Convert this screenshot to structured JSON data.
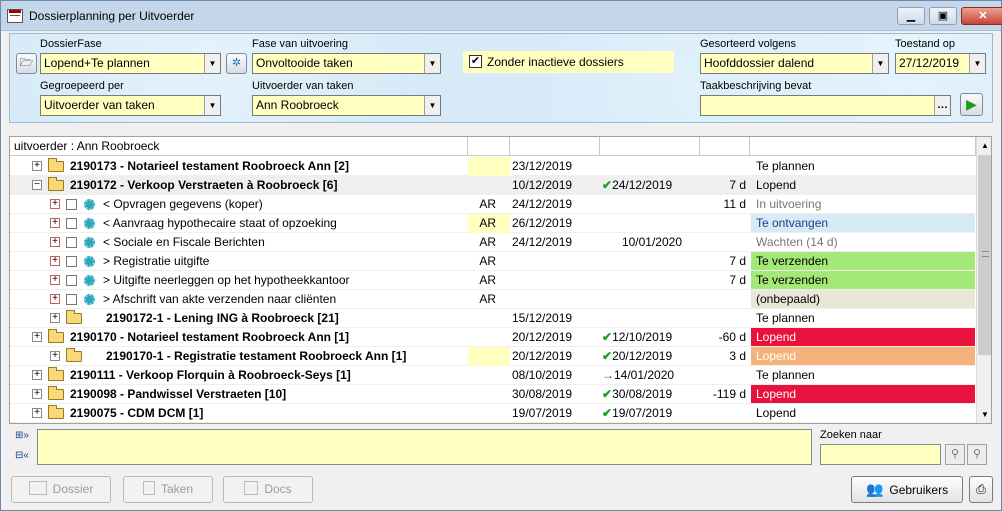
{
  "window": {
    "title": "Dossierplanning per Uitvoerder"
  },
  "filters": {
    "dossierfase_label": "DossierFase",
    "dossierfase_value": "Lopend+Te plannen",
    "fase_label": "Fase van uitvoering",
    "fase_value": "Onvoltooide taken",
    "inactive_label": "Zonder inactieve dossiers",
    "inactive_checked": true,
    "sort_label": "Gesorteerd volgens",
    "sort_value": "Hoofddossier dalend",
    "toestand_label": "Toestand op",
    "toestand_value": "27/12/2019",
    "group_label": "Gegroepeerd per",
    "group_value": "Uitvoerder van taken",
    "uitvoerder_label": "Uitvoerder van taken",
    "uitvoerder_value": "Ann Roobroeck",
    "taak_label": "Taakbeschrijving bevat",
    "taak_value": ""
  },
  "grid": {
    "group_header": "uitvoerder : Ann Roobroeck",
    "rows": [
      {
        "type": "dossier",
        "level": 0,
        "expand": "+",
        "bold": true,
        "title": "2190173 - Notarieel testament Roobroeck Ann [2]",
        "initials": "",
        "yellow": true,
        "date1": "23/12/2019",
        "mark": "",
        "date2": "",
        "days": "",
        "status": "Te plannen",
        "status_color": ""
      },
      {
        "type": "dossier",
        "level": 0,
        "expand": "−",
        "bold": true,
        "hl": true,
        "title": "2190172 - Verkoop Verstraeten à Roobroeck [6]",
        "initials": "",
        "yellow": false,
        "date1": "10/12/2019",
        "mark": "✔",
        "date2": "24/12/2019",
        "days": "7 d",
        "status": "Lopend",
        "status_color": ""
      },
      {
        "type": "task",
        "title": "< Opvragen gegevens (koper)",
        "initials": "AR",
        "yellow": false,
        "date1": "24/12/2019",
        "mark": "",
        "date2": "",
        "days": "11 d",
        "status": "In uitvoering",
        "status_color": "",
        "status_text_color": "#777"
      },
      {
        "type": "task",
        "title": "< Aanvraag hypothecaire staat of opzoeking",
        "initials": "AR",
        "yellow": true,
        "date1": "26/12/2019",
        "mark": "",
        "date2": "",
        "days": "",
        "status": "Te ontvangen",
        "status_color": "#d7ebf6",
        "status_text_color": "#1a3d8a"
      },
      {
        "type": "task",
        "title": "< Sociale en Fiscale Berichten",
        "initials": "AR",
        "yellow": false,
        "date1": "24/12/2019",
        "mark": "",
        "date2": "10/01/2020",
        "days": "",
        "status": "Wachten (14 d)",
        "status_color": "",
        "status_text_color": "#777"
      },
      {
        "type": "task",
        "title": "> Registratie uitgifte",
        "initials": "AR",
        "yellow": false,
        "date1": "",
        "mark": "",
        "date2": "",
        "days": "7 d",
        "status": "Te verzenden",
        "status_color": "#a4e878",
        "status_text_color": "#000"
      },
      {
        "type": "task",
        "title": "> Uitgifte neerleggen op het hypotheekkantoor",
        "initials": "AR",
        "yellow": false,
        "date1": "",
        "mark": "",
        "date2": "",
        "days": "7 d",
        "status": "Te verzenden",
        "status_color": "#a4e878",
        "status_text_color": "#000"
      },
      {
        "type": "task",
        "title": "> Afschrift van akte verzenden naar cliënten",
        "initials": "AR",
        "yellow": false,
        "date1": "",
        "mark": "",
        "date2": "",
        "days": "",
        "status": "(onbepaald)",
        "status_color": "#e8e8d8",
        "status_text_color": "#000"
      },
      {
        "type": "dossier",
        "level": 1,
        "expand": "+",
        "bold": true,
        "title": "2190172-1 - Lening ING à Roobroeck [21]",
        "initials": "",
        "yellow": false,
        "date1": "15/12/2019",
        "mark": "",
        "date2": "",
        "days": "",
        "status": "Te plannen",
        "status_color": ""
      },
      {
        "type": "dossier",
        "level": 0,
        "expand": "+",
        "bold": true,
        "title": "2190170 - Notarieel testament Roobroeck Ann [1]",
        "initials": "",
        "yellow": false,
        "date1": "20/12/2019",
        "mark": "✔",
        "date2": "12/10/2019",
        "days": "-60 d",
        "status": "Lopend",
        "status_color": "#e8123c",
        "status_text_color": "#fff"
      },
      {
        "type": "dossier",
        "level": 1,
        "expand": "+",
        "bold": true,
        "title": "2190170-1 - Registratie testament Roobroeck Ann [1]",
        "initials": "",
        "yellow": true,
        "date1": "20/12/2019",
        "mark": "✔",
        "date2": "20/12/2019",
        "days": "3 d",
        "status": "Lopend",
        "status_color": "#f5b27a",
        "status_text_color": "#fff"
      },
      {
        "type": "dossier",
        "level": 0,
        "expand": "+",
        "bold": true,
        "title": "2190111 - Verkoop Florquin à Roobroeck-Seys [1]",
        "initials": "",
        "yellow": false,
        "date1": "08/10/2019",
        "mark": "→",
        "date2": "14/01/2020",
        "days": "",
        "status": "Te plannen",
        "status_color": ""
      },
      {
        "type": "dossier",
        "level": 0,
        "expand": "+",
        "bold": true,
        "title": "2190098 - Pandwissel Verstraeten [10]",
        "initials": "",
        "yellow": false,
        "date1": "30/08/2019",
        "mark": "✔",
        "date2": "30/08/2019",
        "days": "-119 d",
        "status": "Lopend",
        "status_color": "#e8123c",
        "status_text_color": "#fff"
      },
      {
        "type": "dossier",
        "level": 0,
        "expand": "+",
        "bold": true,
        "title": "2190075 - CDM DCM [1]",
        "initials": "",
        "yellow": false,
        "date1": "19/07/2019",
        "mark": "✔",
        "date2": "19/07/2019",
        "days": "",
        "status": "Lopend",
        "status_color": ""
      }
    ]
  },
  "search": {
    "label": "Zoeken naar",
    "value": ""
  },
  "buttons": {
    "dossier": "Dossier",
    "taken": "Taken",
    "docs": "Docs",
    "gebruikers": "Gebruikers"
  }
}
